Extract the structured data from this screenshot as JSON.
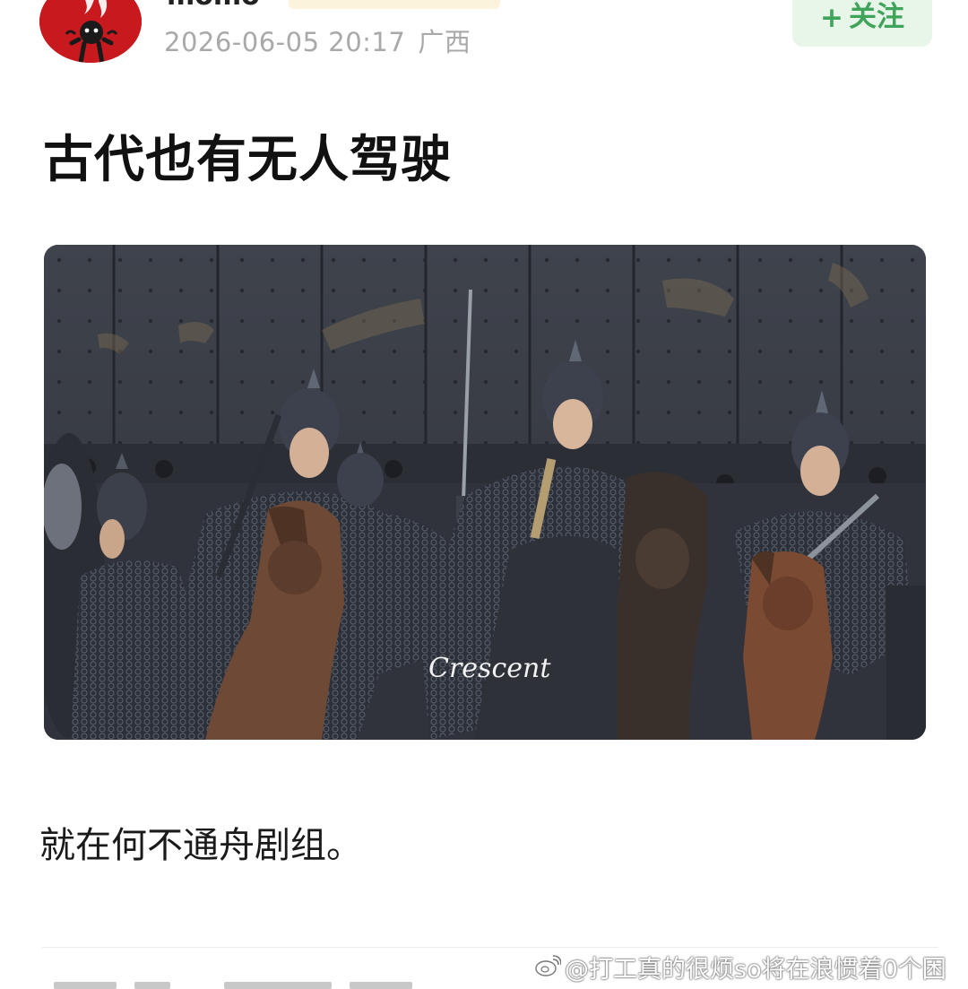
{
  "post": {
    "author": {
      "name": "momo",
      "avatar_icon": "flame-figure-avatar-icon",
      "badge_color": "#fbf3dc"
    },
    "timestamp": "2026-06-05 20:17",
    "location": "广西",
    "follow": {
      "label": "关注",
      "plus": "+",
      "bg_color": "#e8f6ea",
      "text_color": "#3fa35a"
    },
    "title": "古代也有无人驾驶",
    "image": {
      "watermark": "Crescent"
    },
    "body": "就在何不通舟剧组。"
  },
  "watermark": {
    "icon": "weibo-logo-icon",
    "text": "@打工真的很烦so将在浪惯着0个困"
  }
}
